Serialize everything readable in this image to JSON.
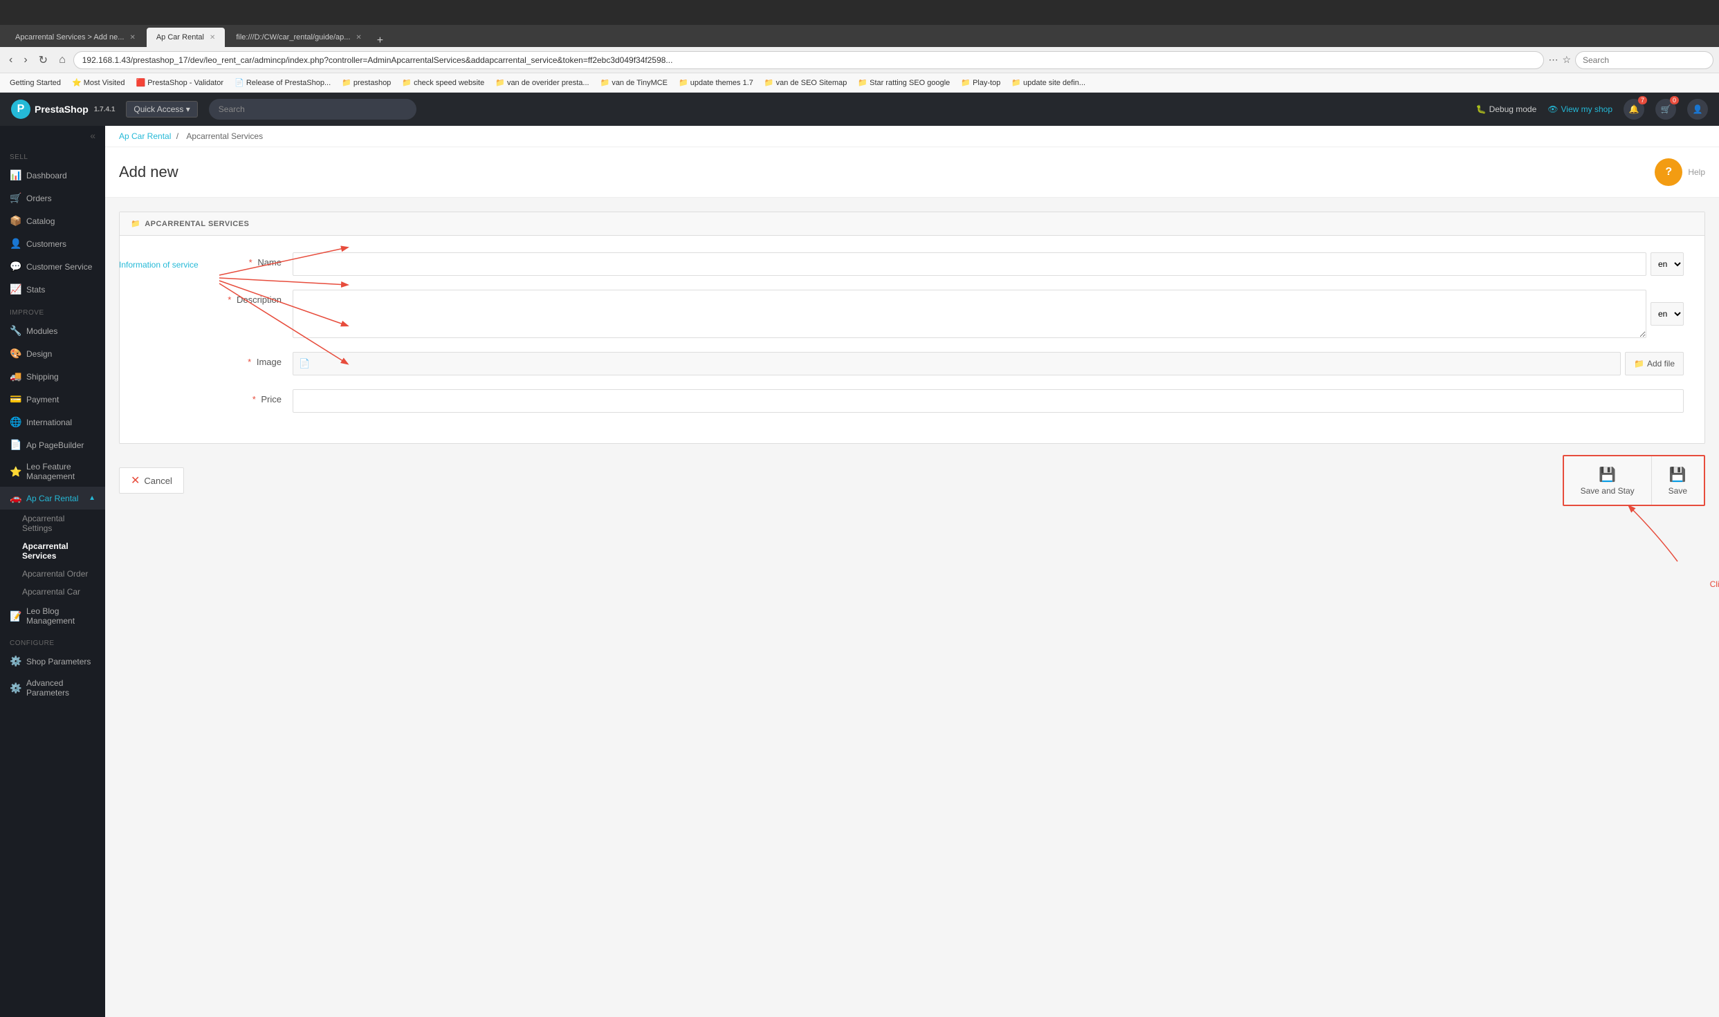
{
  "browser": {
    "tabs": [
      {
        "label": "Apcarrental Services > Add ne...",
        "active": false
      },
      {
        "label": "Ap Car Rental",
        "active": true
      },
      {
        "label": "file:///D:/CW/car_rental/guide/ap...",
        "active": false
      }
    ],
    "address": "192.168.1.43/prestashop_17/dev/leo_rent_car/admincp/index.php?controller=AdminApcarrentalServices&addapcarrental_service&token=ff2ebc3d049f34f2598...",
    "search_placeholder": "Search"
  },
  "bookmarks": [
    "Getting Started",
    "Most Visited",
    "PrestaShop - Validator",
    "Release of PrestaShop...",
    "prestashop",
    "check speed website",
    "van de overider presta...",
    "van de TinyMCE",
    "update themes 1.7",
    "van de SEO Sitemap",
    "Star ratting SEO google",
    "Play-top",
    "update site defin..."
  ],
  "topnav": {
    "logo": "PrestaShop",
    "version": "1.7.4.1",
    "quick_access": "Quick Access ▾",
    "search_placeholder": "Search",
    "debug_mode": "Debug mode",
    "view_my_shop": "View my shop",
    "notifications_count": "7",
    "orders_count": "0"
  },
  "sidebar": {
    "collapse_icon": "«",
    "sections": [
      {
        "label": "SELL",
        "items": [
          {
            "id": "dashboard",
            "icon": "📊",
            "label": "Dashboard"
          },
          {
            "id": "orders",
            "icon": "🛒",
            "label": "Orders"
          },
          {
            "id": "catalog",
            "icon": "📦",
            "label": "Catalog"
          },
          {
            "id": "customers",
            "icon": "👤",
            "label": "Customers"
          },
          {
            "id": "customer-service",
            "icon": "💬",
            "label": "Customer Service"
          },
          {
            "id": "stats",
            "icon": "📈",
            "label": "Stats"
          }
        ]
      },
      {
        "label": "IMPROVE",
        "items": [
          {
            "id": "modules",
            "icon": "🔧",
            "label": "Modules"
          },
          {
            "id": "design",
            "icon": "🎨",
            "label": "Design"
          },
          {
            "id": "shipping",
            "icon": "🚚",
            "label": "Shipping"
          },
          {
            "id": "payment",
            "icon": "💳",
            "label": "Payment"
          },
          {
            "id": "international",
            "icon": "🌐",
            "label": "International"
          },
          {
            "id": "ap-pagebuilder",
            "icon": "📄",
            "label": "Ap PageBuilder"
          },
          {
            "id": "leo-feature",
            "icon": "⭐",
            "label": "Leo Feature Management"
          },
          {
            "id": "ap-car-rental",
            "icon": "🚗",
            "label": "Ap Car Rental",
            "active": true,
            "open": true
          }
        ]
      }
    ],
    "car_rental_sub": [
      {
        "id": "apcarrental-settings",
        "label": "Apcarrental Settings"
      },
      {
        "id": "apcarrental-services",
        "label": "Apcarrental Services",
        "active": true
      },
      {
        "id": "apcarrental-order",
        "label": "Apcarrental Order"
      },
      {
        "id": "apcarrental-car",
        "label": "Apcarrental Car"
      }
    ],
    "more_items": [
      {
        "id": "leo-blog",
        "icon": "📝",
        "label": "Leo Blog Management"
      }
    ],
    "configure": {
      "label": "CONFIGURE",
      "items": [
        {
          "id": "shop-parameters",
          "icon": "⚙️",
          "label": "Shop Parameters"
        },
        {
          "id": "advanced-parameters",
          "icon": "⚙️",
          "label": "Advanced Parameters"
        }
      ]
    }
  },
  "breadcrumb": {
    "items": [
      "Ap Car Rental",
      "Apcarrental Services"
    ],
    "separator": "/"
  },
  "page": {
    "title": "Add new",
    "help_label": "Help"
  },
  "form": {
    "panel_title": "APCARRENTAL SERVICES",
    "fields": {
      "name": {
        "label": "Name",
        "placeholder": ""
      },
      "description": {
        "label": "Description",
        "placeholder": ""
      },
      "image": {
        "label": "Image",
        "placeholder": ""
      },
      "price": {
        "label": "Price",
        "placeholder": ""
      }
    },
    "lang_options": [
      "en"
    ],
    "add_file_label": "Add file",
    "info_of_service_label": "Information of service"
  },
  "actions": {
    "cancel": "Cancel",
    "save_and_stay": "Save and Stay",
    "save": "Save",
    "click_hint": "Click here to save all information"
  }
}
